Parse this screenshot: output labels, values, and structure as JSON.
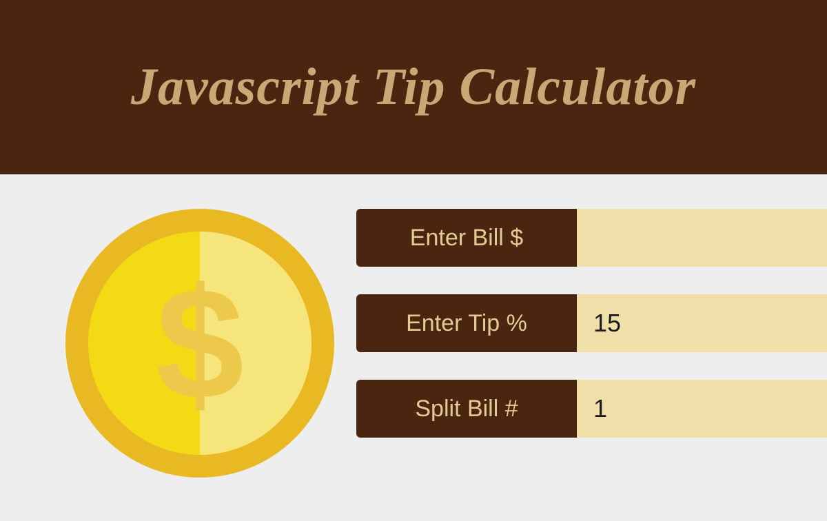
{
  "header": {
    "title": "Javascript Tip Calculator"
  },
  "fields": {
    "bill": {
      "label": "Enter Bill $",
      "value": ""
    },
    "tip": {
      "label": "Enter Tip %",
      "value": "15"
    },
    "split": {
      "label": "Split Bill #",
      "value": "1"
    }
  },
  "colors": {
    "brown": "#4a2611",
    "gold": "#c9a876",
    "inputBg": "#f0dfa8",
    "pageBg": "#eeeeee"
  },
  "icon": {
    "name": "dollar-coin-icon"
  }
}
